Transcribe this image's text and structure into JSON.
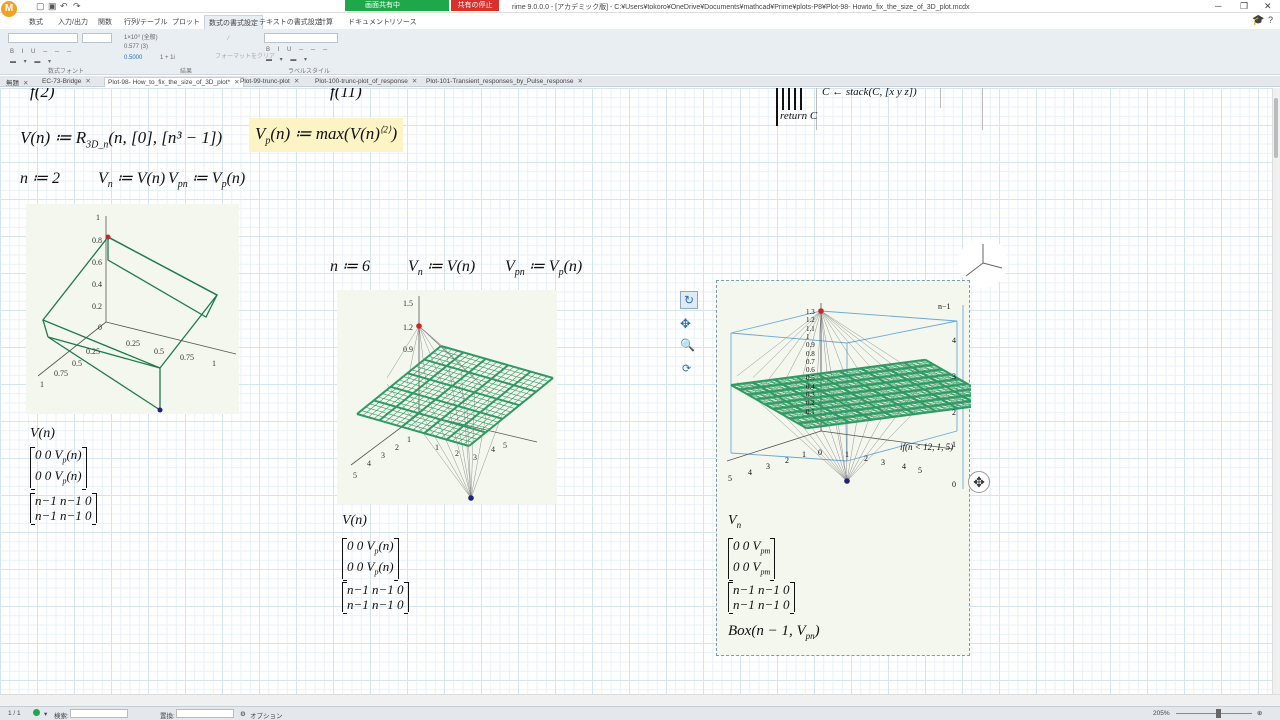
{
  "app": {
    "logo": "M",
    "title": "rime 9.0.0.0 - [アカデミック版] - C:¥Users¥tokoro¥OneDrive¥Documents¥mathcad¥Prime¥plots-P8¥Plot-98- Howto_fix_the_size_of_3D_plot.mcdx",
    "share_label": "画面共有中",
    "share_stop": "共有の停止",
    "win_min": "─",
    "win_restore": "❐",
    "win_close": "✕"
  },
  "ribbon": {
    "tabs": [
      "数式",
      "入力/出力",
      "関数",
      "行列/テーブル",
      "プロット",
      "数式の書式設定",
      "テキストの書式設定",
      "計算",
      "ドキュメント",
      "リソース"
    ],
    "active_tab": "数式の書式設定",
    "font_group": "数式フォント",
    "result_group": "結果",
    "fmt1": "1×10⁰ (全般)",
    "fmt2": "0.577 (3)",
    "fmt3": "0.5000",
    "fmt4": "1 + 1i",
    "labels_style": "ラベルスタイル",
    "clear_label": "フォーマットをクリア"
  },
  "doctabs": [
    {
      "label": "無題",
      "active": false
    },
    {
      "label": "EC-73-Bridge",
      "active": false
    },
    {
      "label": "Plot-98- How_to_fix_the_size_of_3D_plot*",
      "active": true
    },
    {
      "label": "Plot-99-trunc-plot",
      "active": false
    },
    {
      "label": "Plot-100-trunc-plot_of_response",
      "active": false
    },
    {
      "label": "Plot-101-Transient_responses_by_Pulse_response",
      "active": false
    }
  ],
  "worksheet": {
    "f2": "f(2)",
    "f11": "f(11)",
    "stack_line": "C ← stack(C, [x  y  z])",
    "return_line": "return C",
    "def_V": "V(n) ≔ R",
    "def_V_sub": "3D_n",
    "def_V_args": "(n, [0], [n³ − 1])",
    "def_Vp": "V",
    "def_Vp_sub": "p",
    "def_Vp_rest": "(n) ≔ max(V(n)",
    "def_Vp_sup": "⟨2⟩",
    "def_Vp_end": ")",
    "n2": "n ≔ 2",
    "vn2": "V",
    "vn2_sub": "n",
    "vn2_rest": " ≔ V(n)",
    "vpn2": "V",
    "vpn2_sub": "pn",
    "vpn2_rest": " ≔ V",
    "vpn2_sub2": "p",
    "vpn2_end": "(n)",
    "n6": "n ≔ 6",
    "vn6_rest": " ≔ V(n)",
    "vpn6_rest": " ≔ V",
    "vpn6_end": "(n)",
    "vlabel1": "V(n)",
    "vlabel2": "V(n)",
    "vlabel3": "V",
    "vlabel3_sub": "n",
    "mat_a": [
      "0  0  V",
      "0  0  V"
    ],
    "mat_a_sub": "p",
    "mat_a_end": "(n)",
    "mat_b": [
      "n−1  n−1  0",
      "n−1  n−1  0"
    ],
    "mat_c_sub": "pm",
    "box_expr": "Box(n − 1, V",
    "box_sub": "pn",
    "box_end": ")",
    "if_label": "if(n < 12, 1, 5)",
    "plot1_yticks": [
      "1",
      "0.8",
      "0.6",
      "0.4",
      "0.2",
      "0"
    ],
    "plot1_xticks": [
      "0.25",
      "0.5",
      "0.75",
      "1"
    ],
    "plot1_ztick": [
      "0.25",
      "0.5",
      "0.75",
      "1"
    ],
    "plot2_yticks": [
      "1.5",
      "1.2",
      "0.9"
    ],
    "plot2_xticks": [
      "1",
      "2",
      "3",
      "4",
      "5"
    ],
    "plot2_ztick": [
      "5",
      "4",
      "3",
      "2",
      "1"
    ],
    "plot3_yticks": [
      "1.3",
      "1.2",
      "1.1",
      "1",
      "0.9",
      "0.8",
      "0.7",
      "0.6",
      "0.5",
      "0.4",
      "0.3",
      "0.2",
      "0.1"
    ],
    "plot3_xticks": [
      "0",
      "1",
      "2",
      "3",
      "4",
      "5"
    ],
    "plot3_zticks": [
      "5",
      "4",
      "3",
      "2",
      "1"
    ],
    "scale_ticks": [
      "n−1",
      "4",
      "3",
      "2",
      "1",
      "0"
    ]
  },
  "status": {
    "page": "1 / 1",
    "search_label": "検索:",
    "replace_label": "置換:",
    "options_label": "オプション",
    "zoom": "205%"
  },
  "colors": {
    "accent_green": "#1d7a4b",
    "share_green": "#1fa84b",
    "stop_red": "#d9302b",
    "grid": "#d4e4f0",
    "region_bg": "#f3f7ee",
    "highlight": "#fcf4c4"
  }
}
